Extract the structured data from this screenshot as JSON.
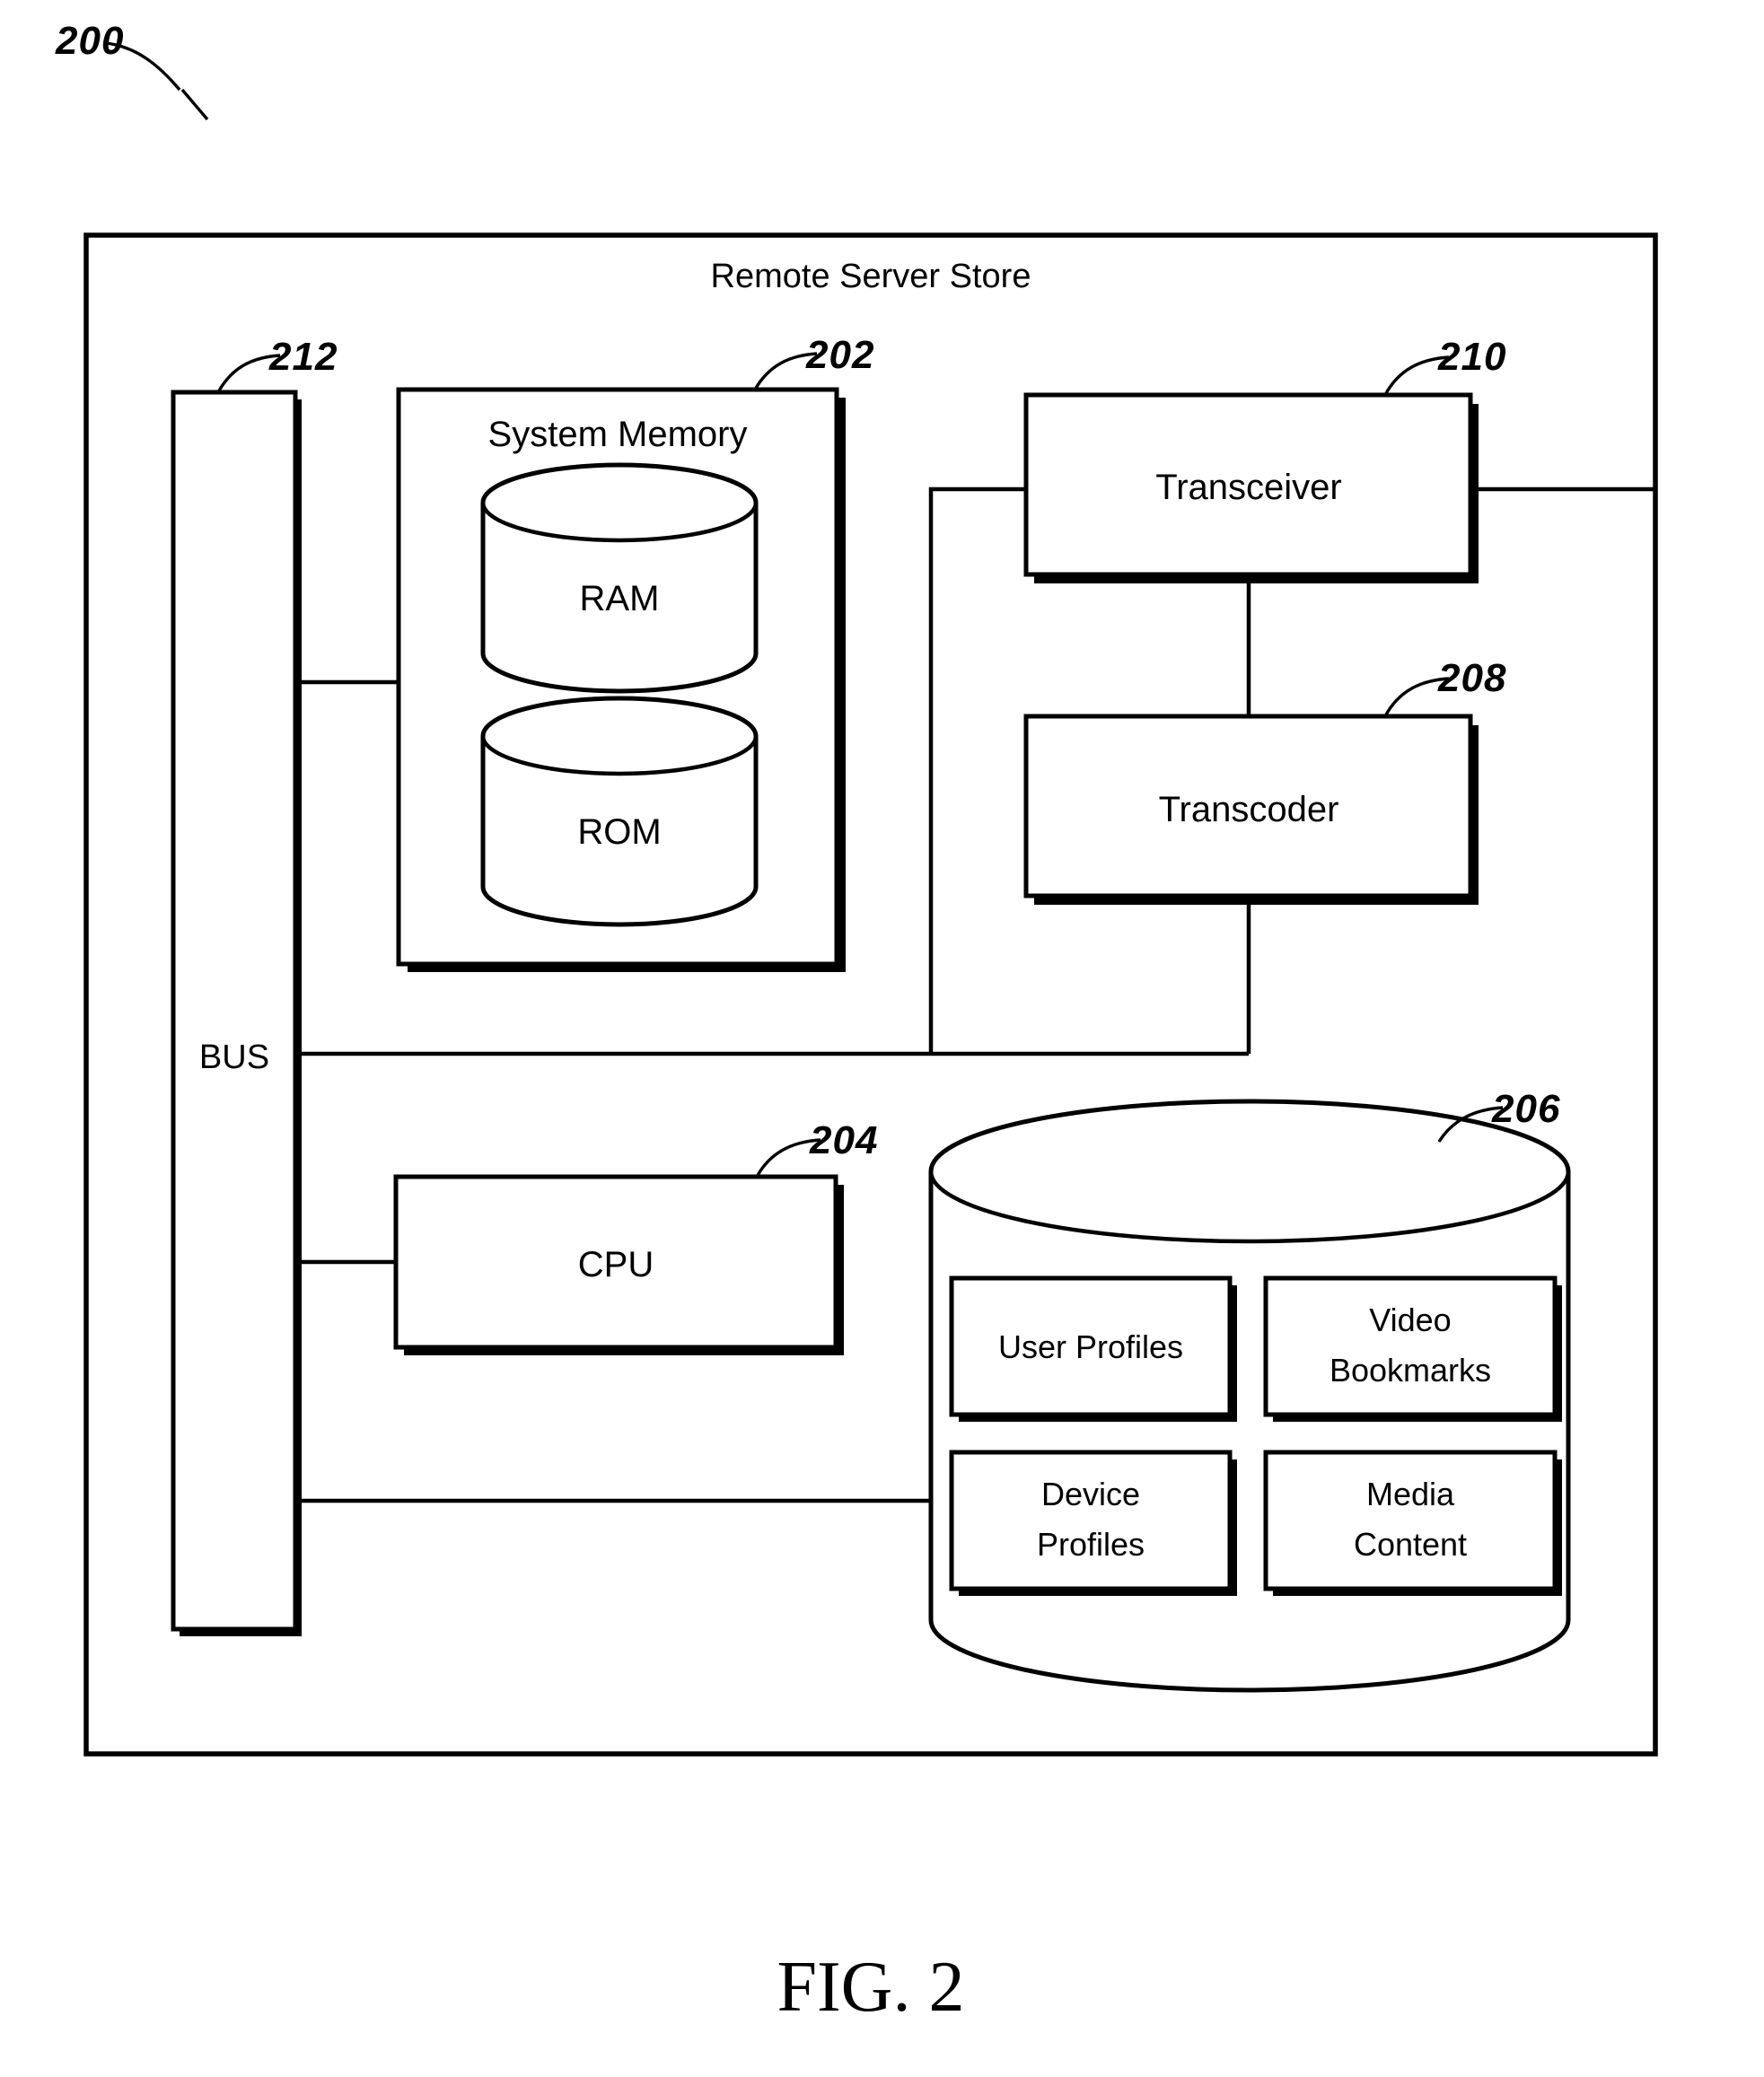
{
  "figure": {
    "caption": "FIG. 2",
    "root_reference": "200",
    "outer_title": "Remote Server Store"
  },
  "references": {
    "bus": "212",
    "system_memory": "202",
    "transceiver": "210",
    "transcoder": "208",
    "cpu": "204",
    "database": "206"
  },
  "blocks": {
    "bus_label": "BUS",
    "system_memory_label": "System Memory",
    "ram_label": "RAM",
    "rom_label": "ROM",
    "transceiver_label": "Transceiver",
    "transcoder_label": "Transcoder",
    "cpu_label": "CPU"
  },
  "database_items": [
    {
      "id": "user-profiles",
      "line1": "User Profiles",
      "line2": ""
    },
    {
      "id": "video-bookmarks",
      "line1": "Video",
      "line2": "Bookmarks"
    },
    {
      "id": "device-profiles",
      "line1": "Device",
      "line2": "Profiles"
    },
    {
      "id": "media-content",
      "line1": "Media",
      "line2": "Content"
    }
  ],
  "colors": {
    "ink": "#000000",
    "paper": "#ffffff"
  }
}
